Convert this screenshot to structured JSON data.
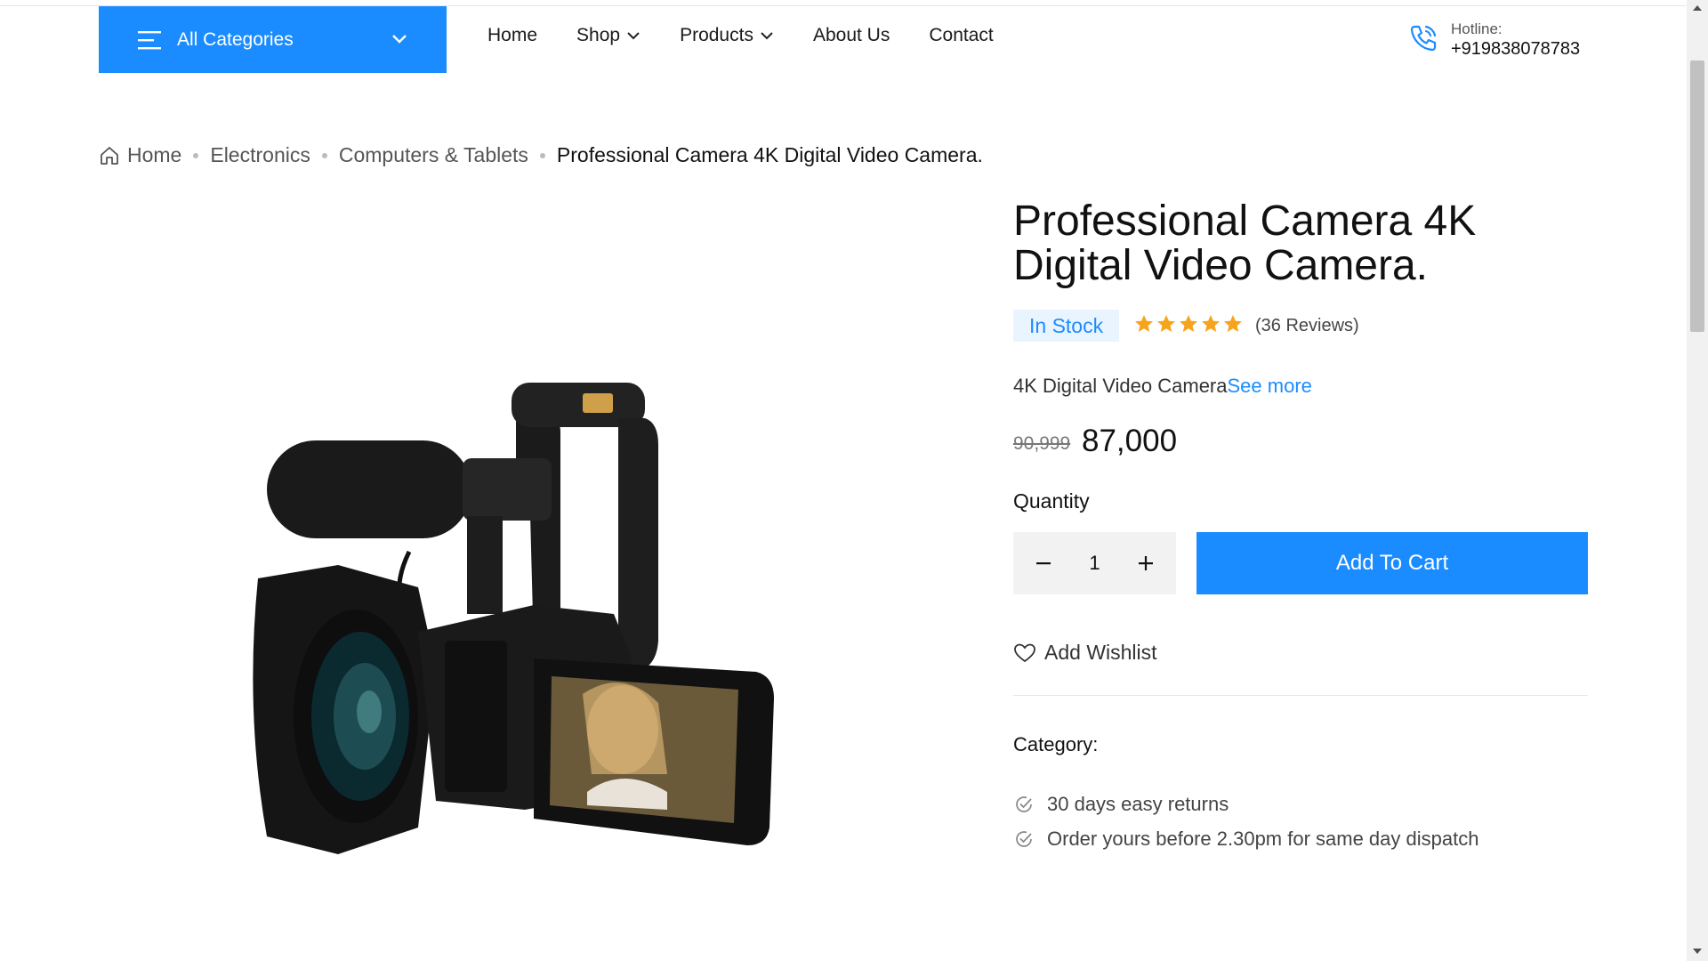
{
  "header": {
    "categories_label": "All Categories",
    "nav": [
      {
        "label": "Home",
        "dropdown": false
      },
      {
        "label": "Shop",
        "dropdown": true
      },
      {
        "label": "Products",
        "dropdown": true
      },
      {
        "label": "About Us",
        "dropdown": false
      },
      {
        "label": "Contact",
        "dropdown": false
      }
    ],
    "hotline_label": "Hotline:",
    "hotline_number": "+919838078783"
  },
  "breadcrumb": {
    "items": [
      "Home",
      "Electronics",
      "Computers & Tablets"
    ],
    "current": "Professional Camera 4K Digital Video Camera."
  },
  "product": {
    "title": "Professional Camera 4K Digital Video Camera.",
    "stock": "In Stock",
    "rating": 5,
    "reviews": "(36 Reviews)",
    "short_desc": "4K Digital Video Camera",
    "see_more": "See more",
    "old_price": "90,999",
    "price": "87,000",
    "quantity_label": "Quantity",
    "quantity": "1",
    "add_to_cart": "Add To Cart",
    "wishlist": "Add Wishlist",
    "category_label": "Category:",
    "features": [
      "30 days easy returns",
      "Order yours before 2.30pm for same day dispatch"
    ]
  },
  "colors": {
    "accent": "#1a8cff",
    "star": "#f7a41d",
    "stock_bg": "#eaf4ff"
  },
  "icons": [
    "menu-icon",
    "chevron-down-icon",
    "phone-icon",
    "home-icon",
    "star-icon",
    "minus-icon",
    "plus-icon",
    "heart-icon",
    "check-circle-icon"
  ]
}
